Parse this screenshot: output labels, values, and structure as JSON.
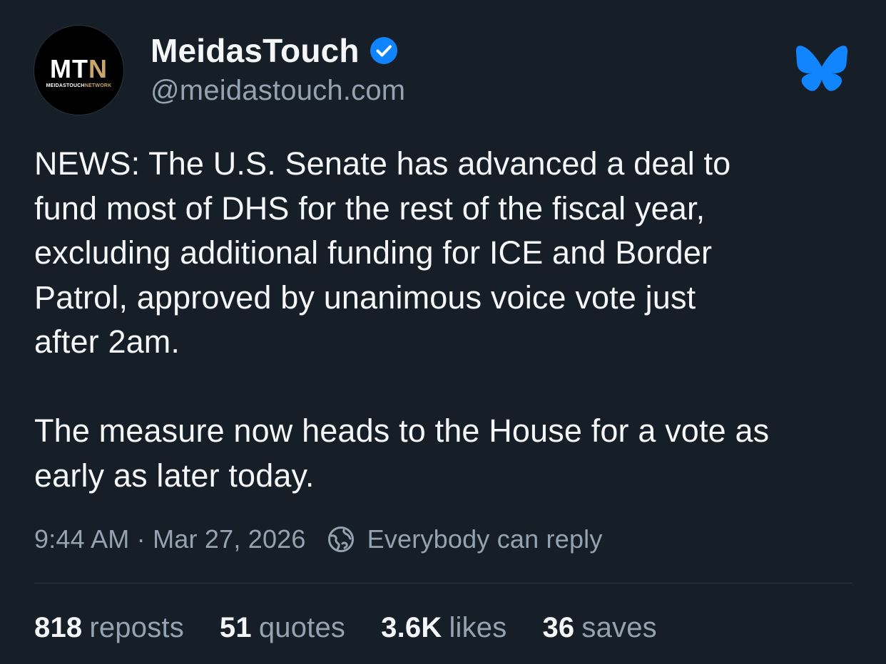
{
  "author": {
    "avatar": {
      "logo_main": "MT",
      "logo_accent": "N",
      "logo_sub_main": "MEIDASTOUCH",
      "logo_sub_accent": "NETWORK"
    },
    "display_name": "MeidasTouch",
    "handle": "@meidastouch.com",
    "verified": true
  },
  "post": {
    "text": "NEWS: The U.S. Senate has advanced a deal to\nfund most of DHS for the rest of the fiscal year,\nexcluding additional funding for ICE and Border\nPatrol, approved by unanimous voice vote just\nafter 2am.\n\nThe measure now heads to the House for a vote as\nearly as later today.",
    "timestamp": "9:44 AM · Mar 27, 2026",
    "reply_setting": "Everybody can reply"
  },
  "stats": {
    "reposts": {
      "count": "818",
      "label": "reposts"
    },
    "quotes": {
      "count": "51",
      "label": "quotes"
    },
    "likes": {
      "count": "3.6K",
      "label": "likes"
    },
    "saves": {
      "count": "36",
      "label": "saves"
    }
  },
  "icons": {
    "verified": "verified-checkmark-icon",
    "platform": "bluesky-butterfly-icon",
    "reply_setting": "globe-icon"
  },
  "colors": {
    "background": "#161e27",
    "text_primary": "#f4f6f8",
    "text_secondary": "#95a2b1",
    "verified_badge": "#1083fe",
    "bluesky_brand": "#1185fe",
    "avatar_accent": "#c9a56a"
  }
}
